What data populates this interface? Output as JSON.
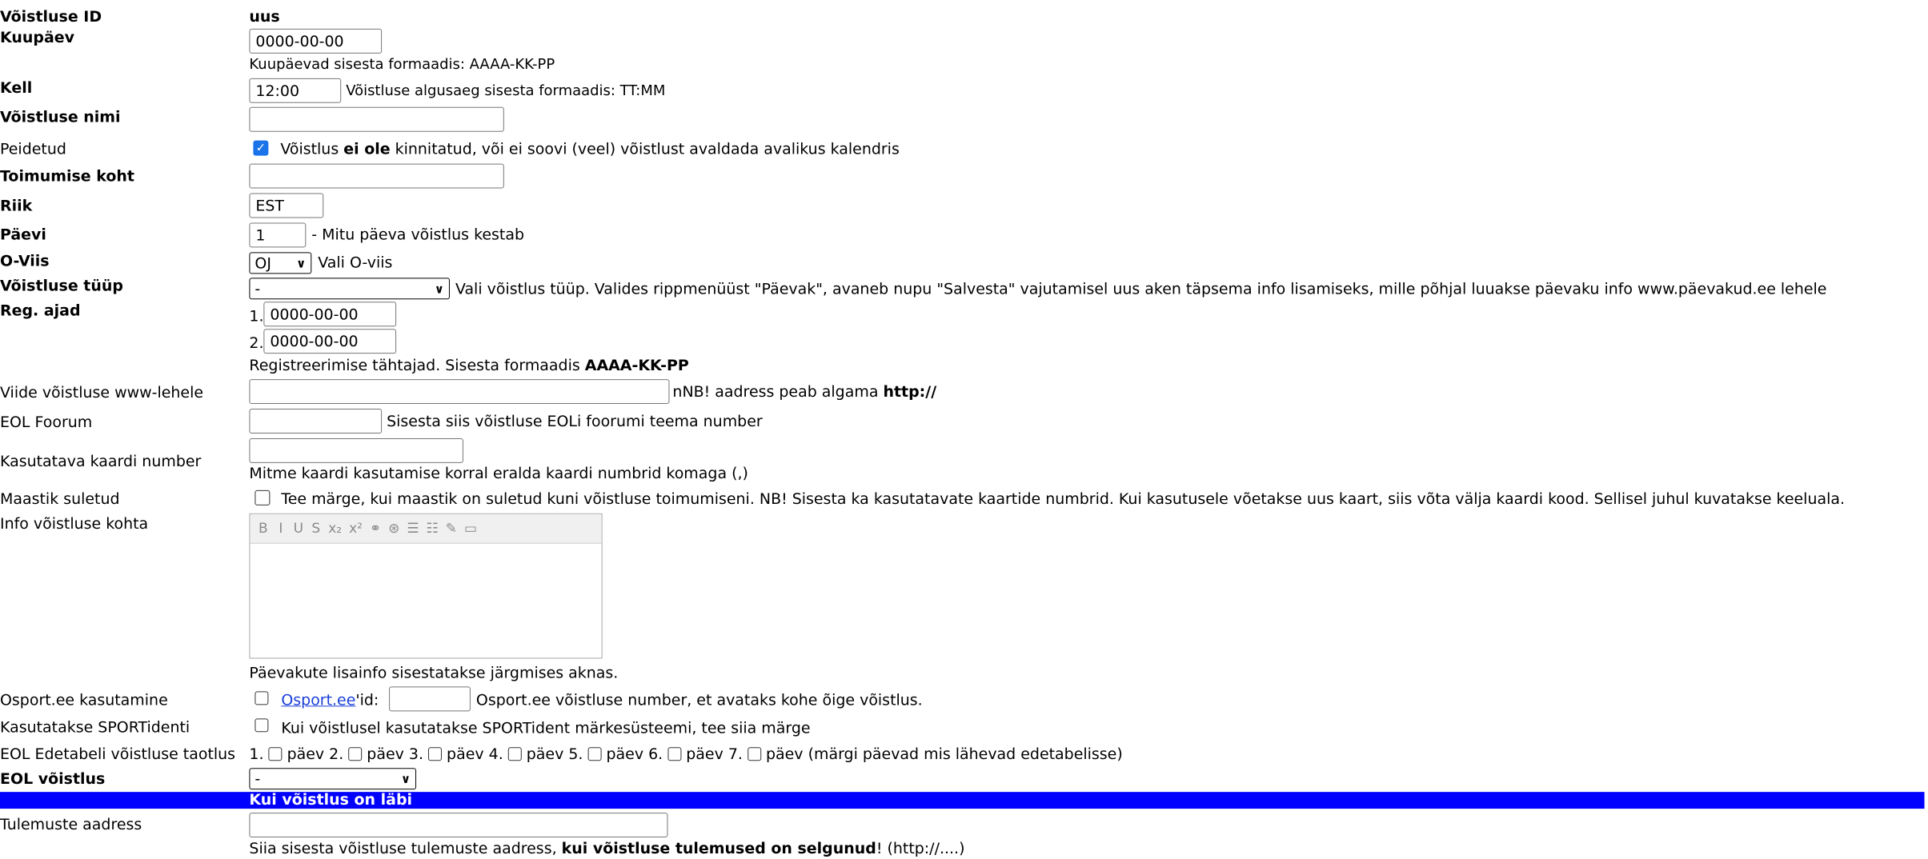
{
  "fields": {
    "competition_id": {
      "label": "Võistluse ID",
      "value": "uus"
    },
    "date": {
      "label": "Kuupäev",
      "value": "0000-00-00",
      "hint": "Kuupäevad sisesta formaadis: AAAA-KK-PP"
    },
    "time": {
      "label": "Kell",
      "value": "12:00",
      "hint": "Võistluse algusaeg sisesta formaadis: TT:MM"
    },
    "name": {
      "label": "Võistluse nimi",
      "value": ""
    },
    "hidden": {
      "label": "Peidetud",
      "checked": true,
      "text_pre": "Võistlus ",
      "text_bold": "ei ole",
      "text_post": " kinnitatud, või ei soovi (veel) võistlust avaldada avalikus kalendris"
    },
    "location": {
      "label": "Toimumise koht",
      "value": ""
    },
    "country": {
      "label": "Riik",
      "value": "EST"
    },
    "days": {
      "label": "Päevi",
      "value": "1",
      "hint": "- Mitu päeva võistlus kestab"
    },
    "oviis": {
      "label": "O-Viis",
      "selected": "OJ",
      "hint": "Vali O-viis"
    },
    "type": {
      "label": "Võistluse tüüp",
      "selected": "-",
      "hint": "Vali võistlus tüüp. Valides rippmenüüst \"Päevak\", avaneb nupu \"Salvesta\" vajutamisel uus aken täpsema info lisamiseks, mille põhjal luuakse päevaku info www.päevakud.ee lehele"
    },
    "reg": {
      "label": "Reg. ajad",
      "n1": "1.",
      "v1": "0000-00-00",
      "n2": "2.",
      "v2": "0000-00-00",
      "hint_pre": "Registreerimise tähtajad. Sisesta formaadis ",
      "hint_bold": "AAAA-KK-PP"
    },
    "www": {
      "label": "Viide võistluse www-lehele",
      "value": "",
      "hint_pre": "nNB! aadress peab algama ",
      "hint_bold": "http://"
    },
    "eol_forum": {
      "label": "EOL Foorum",
      "value": "",
      "hint": "Sisesta siis võistluse EOLi foorumi teema number"
    },
    "map_number": {
      "label": "Kasutatava kaardi number",
      "value": "",
      "hint": "Mitme kaardi kasutamise korral eralda kaardi numbrid komaga (,)"
    },
    "terrain_closed": {
      "label": "Maastik suletud",
      "checked": false,
      "text": "Tee märge, kui maastik on suletud kuni võistluse toimumiseni. NB! Sisesta ka kasutatavate kaartide numbrid. Kui kasutusele võetakse uus kaart, siis võta välja kaardi kood. Sellisel juhul kuvatakse keeluala."
    },
    "info": {
      "label": "Info võistluse kohta",
      "toolbar": [
        "B",
        "I",
        "U",
        "S",
        "x₂",
        "x²",
        "⚭",
        "⊛",
        "☰",
        "☷",
        "✎",
        "▭"
      ],
      "note": "Päevakute lisainfo sisestatakse järgmises aknas."
    },
    "osport": {
      "label": "Osport.ee kasutamine",
      "link": "Osport.ee",
      "link_suffix": "'id:",
      "value": "",
      "hint": "Osport.ee võistluse number, et avataks kohe õige võistlus."
    },
    "sportident": {
      "label": "Kasutatakse SPORTidenti",
      "text": "Kui võistlusel kasutatakse SPORTident märkesüsteemi, tee siia märge"
    },
    "ranking": {
      "label": "EOL Edetabeli võistluse taotlus",
      "days": [
        {
          "n": "1.",
          "t": "päev"
        },
        {
          "n": "2.",
          "t": "päev"
        },
        {
          "n": "3.",
          "t": "päev"
        },
        {
          "n": "4.",
          "t": "päev"
        },
        {
          "n": "5.",
          "t": "päev"
        },
        {
          "n": "6.",
          "t": "päev"
        },
        {
          "n": "7.",
          "t": "päev"
        }
      ],
      "tail": "(märgi päevad mis lähevad edetabelisse)"
    },
    "eol_comp": {
      "label": "EOL võistlus",
      "selected": "-"
    }
  },
  "after": {
    "title": "Kui võistlus on läbi",
    "results": {
      "label": "Tulemuste aadress",
      "value": "",
      "hint_pre": "Siia sisesta võistluse tulemuste aadress, ",
      "hint_bold": "kui võistluse tulemused on selgunud",
      "hint_post": "! (http://....)"
    }
  }
}
